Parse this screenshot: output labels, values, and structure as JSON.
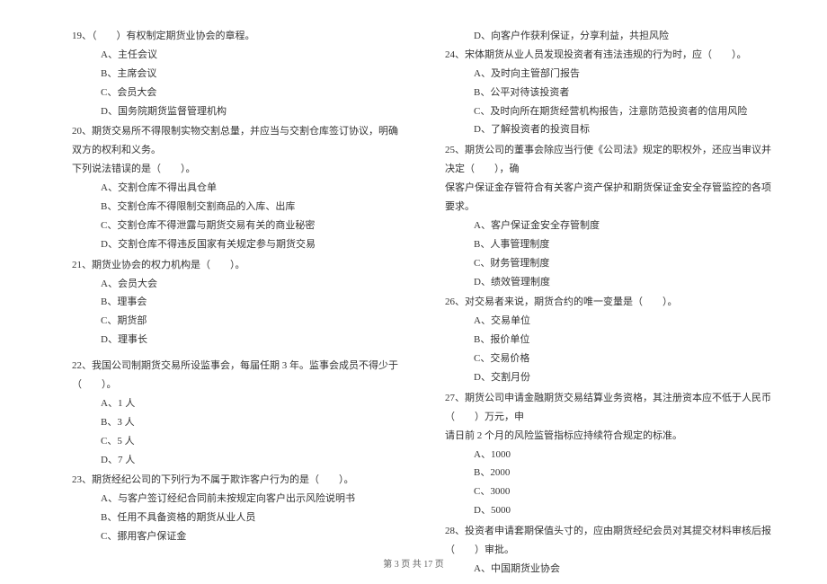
{
  "left": {
    "q19": {
      "stem": "19、（　　）有权制定期货业协会的章程。",
      "A": "A、主任会议",
      "B": "B、主席会议",
      "C": "C、会员大会",
      "D": "D、国务院期货监督管理机构"
    },
    "q20": {
      "stem": "20、期货交易所不得限制实物交割总量，并应当与交割仓库签订协议，明确双方的权利和义务。",
      "cont": "下列说法错误的是（　　）。",
      "A": "A、交割仓库不得出具仓单",
      "B": "B、交割仓库不得限制交割商品的入库、出库",
      "C": "C、交割仓库不得泄露与期货交易有关的商业秘密",
      "D": "D、交割仓库不得违反国家有关规定参与期货交易"
    },
    "q21": {
      "stem": "21、期货业协会的权力机构是（　　）。",
      "A": "A、会员大会",
      "B": "B、理事会",
      "C": "C、期货部",
      "D": "D、理事长"
    },
    "q22": {
      "stem": "22、我国公司制期货交易所设监事会，每届任期 3 年。监事会成员不得少于（　　）。",
      "A": "A、1 人",
      "B": "B、3 人",
      "C": "C、5 人",
      "D": "D、7 人"
    },
    "q23": {
      "stem": "23、期货经纪公司的下列行为不属于欺诈客户行为的是（　　）。",
      "A": "A、与客户签订经纪合同前未按规定向客户出示风险说明书",
      "B": "B、任用不具备资格的期货从业人员",
      "C": "C、挪用客户保证金"
    }
  },
  "right": {
    "q23D": "D、向客户作获利保证，分享利益，共担风险",
    "q24": {
      "stem": "24、宋体期货从业人员发现投资者有违法违规的行为时，应（　　）。",
      "A": "A、及时向主管部门报告",
      "B": "B、公平对待该投资者",
      "C": "C、及时向所在期货经营机构报告，注意防范投资者的信用风险",
      "D": "D、了解投资者的投资目标"
    },
    "q25": {
      "stem": "25、期货公司的董事会除应当行使《公司法》规定的职权外，还应当审议并决定（　　），确",
      "cont": "保客户保证金存管符合有关客户资产保护和期货保证金安全存管监控的各项要求。",
      "A": "A、客户保证金安全存管制度",
      "B": "B、人事管理制度",
      "C": "C、财务管理制度",
      "D": "D、绩效管理制度"
    },
    "q26": {
      "stem": "26、对交易者来说，期货合约的唯一变量是（　　）。",
      "A": "A、交易单位",
      "B": "B、报价单位",
      "C": "C、交易价格",
      "D": "D、交割月份"
    },
    "q27": {
      "stem": "27、期货公司申请金融期货交易结算业务资格，其注册资本应不低于人民币（　　）万元，申",
      "cont": "请日前 2 个月的风险监管指标应持续符合规定的标准。",
      "A": "A、1000",
      "B": "B、2000",
      "C": "C、3000",
      "D": "D、5000"
    },
    "q28": {
      "stem": "28、投资者申请套期保值头寸的，应由期货经纪会员对其提交材料审核后报（　　）审批。",
      "A": "A、中国期货业协会"
    }
  },
  "footer": "第 3 页 共 17 页"
}
